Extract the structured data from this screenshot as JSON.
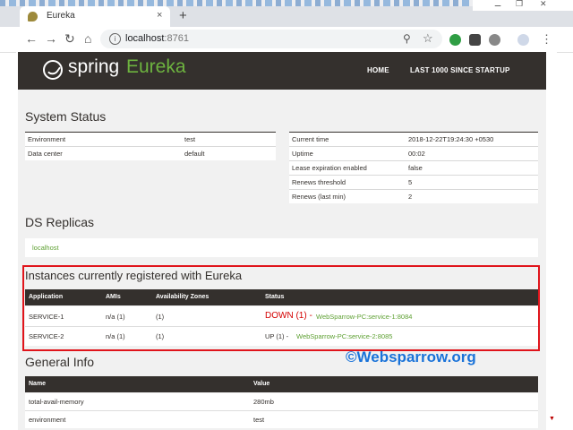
{
  "browser": {
    "tab_title": "Eureka",
    "tab_close": "×",
    "new_tab": "+",
    "window_controls": [
      "⚊",
      "❐",
      "✕"
    ],
    "back": "←",
    "forward": "→",
    "reload": "↻",
    "home": "⌂",
    "info": "i",
    "url_host": "localhost",
    "url_port": ":8761",
    "zoom": "⚲",
    "star": "☆"
  },
  "navbar": {
    "logo_spring": "spring",
    "logo_eureka": "Eureka",
    "links": [
      "HOME",
      "LAST 1000 SINCE STARTUP"
    ]
  },
  "system_status": {
    "title": "System Status",
    "left": [
      {
        "key": "Environment",
        "value": "test"
      },
      {
        "key": "Data center",
        "value": "default"
      }
    ],
    "right": [
      {
        "key": "Current time",
        "value": "2018-12-22T19:24:30 +0530"
      },
      {
        "key": "Uptime",
        "value": "00:02"
      },
      {
        "key": "Lease expiration enabled",
        "value": "false"
      },
      {
        "key": "Renews threshold",
        "value": "5"
      },
      {
        "key": "Renews (last min)",
        "value": "2"
      }
    ]
  },
  "ds_replicas": {
    "title": "DS Replicas",
    "items": [
      "localhost"
    ]
  },
  "instances": {
    "title": "Instances currently registered with Eureka",
    "headers": [
      "Application",
      "AMIs",
      "Availability Zones",
      "Status"
    ],
    "rows": [
      {
        "application": "SERVICE-1",
        "amis": "n/a (1)",
        "zones": "(1)",
        "status": "DOWN (1) -",
        "instance": "WebSparrow-PC:service-1:8084",
        "status_color": "#d40000"
      },
      {
        "application": "SERVICE-2",
        "amis": "n/a (1)",
        "zones": "(1)",
        "status": "UP (1) -",
        "instance": "WebSparrow-PC:service-2:8085",
        "status_color": "#34302d"
      }
    ]
  },
  "general_info": {
    "title": "General Info",
    "headers": [
      "Name",
      "Value"
    ],
    "rows": [
      {
        "name": "total-avail-memory",
        "value": "280mb"
      },
      {
        "name": "environment",
        "value": "test"
      }
    ]
  },
  "watermark": "©Websparrow.org",
  "colors": {
    "accent_green": "#6db33f",
    "nav_dark": "#34302d",
    "highlight_red": "#e0141b",
    "watermark_blue": "#1a73d9"
  }
}
